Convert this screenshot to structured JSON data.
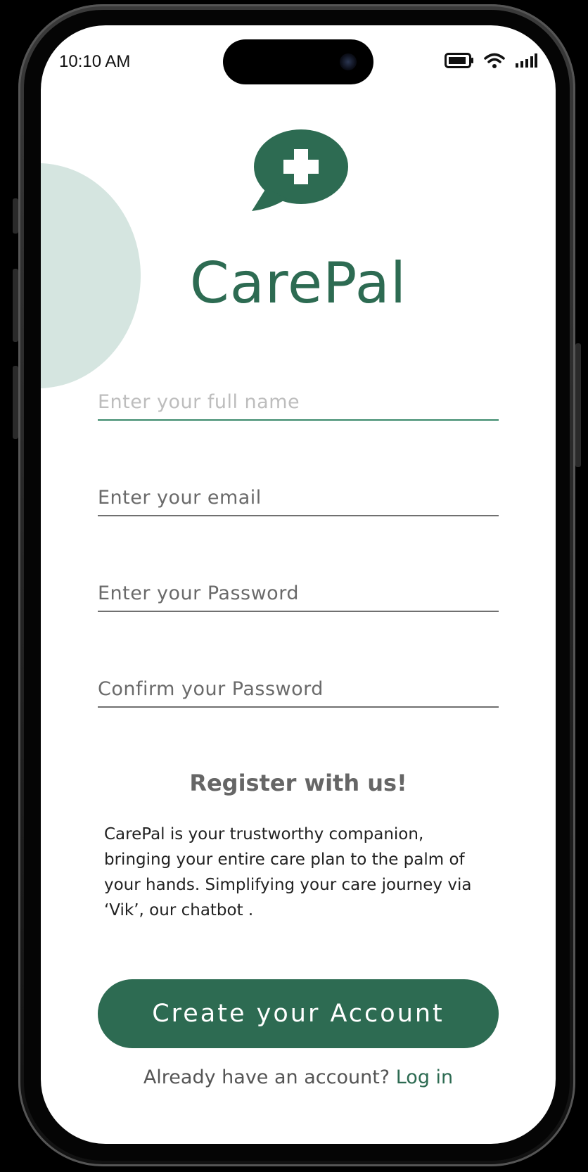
{
  "status_bar": {
    "time": "10:10 AM"
  },
  "app": {
    "name": "CarePal"
  },
  "form": {
    "full_name_placeholder": "Enter your full name",
    "email_placeholder": "Enter your email",
    "password_placeholder": "Enter your Password",
    "confirm_password_placeholder": "Confirm your Password"
  },
  "info": {
    "heading": "Register with us!",
    "description": "CarePal is your trustworthy companion, bringing your entire care plan to the palm of your hands. Simplifying your care journey via ‘Vik’, our chatbot ."
  },
  "actions": {
    "create_account_label": "Create your Account",
    "login_prompt": "Already have an account?",
    "login_link": "Log in"
  },
  "colors": {
    "brand": "#2d6b52",
    "decor_circle": "#d5e5e0",
    "active_underline": "#3b8a6c"
  },
  "icons": [
    "battery-icon",
    "wifi-icon",
    "signal-icon",
    "chat-plus-logo-icon"
  ]
}
